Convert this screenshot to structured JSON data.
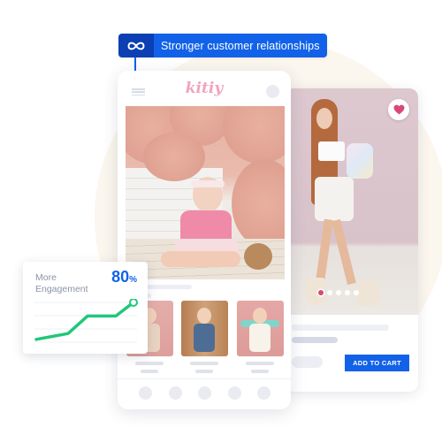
{
  "banner": {
    "icon": "infinity-icon",
    "text": "Stronger customer relationships",
    "colors": {
      "icon_bg": "#0b3fb3",
      "text_bg": "#1262e9"
    }
  },
  "phone": {
    "logo": "kitiy",
    "menu_icon": "hamburger-menu-icon",
    "main_image": "baby-with-paper-flowers-photo",
    "thumbnails": [
      {
        "image": "toddler-in-sun-hat-photo"
      },
      {
        "image": "toddler-in-denim-overalls-photo"
      },
      {
        "image": "girl-with-skateboard-photo"
      }
    ],
    "bottom_nav_count": 5
  },
  "product_card": {
    "image": "girl-with-backpack-photo",
    "favorite_icon": "heart-icon",
    "carousel": {
      "total": 5,
      "active_index": 0
    },
    "add_to_cart_label": "ADD TO CART",
    "colors": {
      "heart": "#d9487a",
      "button": "#1262e9"
    }
  },
  "engagement": {
    "label": "More Engagement",
    "value": "80",
    "unit": "%",
    "trend": [
      0.05,
      0.2,
      0.65,
      0.65,
      1.0
    ],
    "line_color": "#22c77a"
  }
}
